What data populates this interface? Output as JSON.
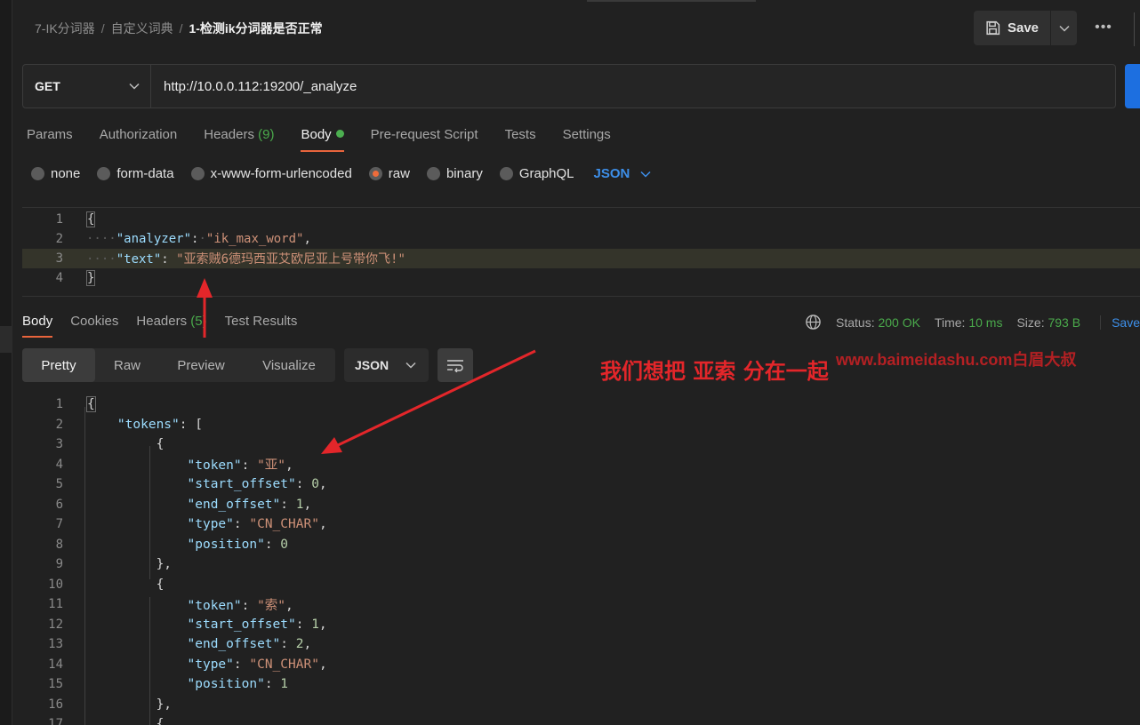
{
  "breadcrumb": {
    "items": [
      "7-IK分词器",
      "自定义词典"
    ],
    "current": "1-检测ik分词器是否正常",
    "separator": "/"
  },
  "toolbar": {
    "save_label": "Save",
    "more_label": "•••"
  },
  "request": {
    "method": "GET",
    "url": "http://10.0.0.112:19200/_analyze",
    "tabs": [
      "Params",
      "Authorization",
      "Headers",
      "Body",
      "Pre-request Script",
      "Tests",
      "Settings"
    ],
    "headers_count": "(9)",
    "active_tab": "Body",
    "body_types": [
      "none",
      "form-data",
      "x-www-form-urlencoded",
      "raw",
      "binary",
      "GraphQL"
    ],
    "selected_body_type": "raw",
    "raw_format": "JSON",
    "line_numbers": [
      "1",
      "2",
      "3",
      "4"
    ],
    "body": {
      "open": "{",
      "close": "}",
      "k1": "\"analyzer\"",
      "v1": "\"ik_max_word\"",
      "k2": "\"text\"",
      "v2": "\"亚索贼6德玛西亚艾欧尼亚上号带你飞!\""
    }
  },
  "response": {
    "tabs": [
      "Body",
      "Cookies",
      "Headers",
      "Test Results"
    ],
    "headers_count": "(5)",
    "active_tab": "Body",
    "status_label": "Status:",
    "status_value": "200 OK",
    "time_label": "Time:",
    "time_value": "10 ms",
    "size_label": "Size:",
    "size_value": "793 B",
    "save_label": "Save",
    "views": [
      "Pretty",
      "Raw",
      "Preview",
      "Visualize"
    ],
    "active_view": "Pretty",
    "format": "JSON",
    "line_numbers": [
      "1",
      "2",
      "3",
      "4",
      "5",
      "6",
      "7",
      "8",
      "9",
      "10",
      "11",
      "12",
      "13",
      "14",
      "15",
      "16",
      "17"
    ],
    "body": {
      "open": "{",
      "tokens_key": "\"tokens\"",
      "arr_open": "[",
      "obj_open": "{",
      "obj_close": "},",
      "k_token": "\"token\"",
      "k_start": "\"start_offset\"",
      "k_end": "\"end_offset\"",
      "k_type": "\"type\"",
      "k_pos": "\"position\"",
      "t1": {
        "token": "\"亚\"",
        "start": "0",
        "end": "1",
        "type": "\"CN_CHAR\"",
        "pos": "0"
      },
      "t2": {
        "token": "\"索\"",
        "start": "1",
        "end": "2",
        "type": "\"CN_CHAR\"",
        "pos": "1"
      }
    }
  },
  "annotation": {
    "text": "我们想把 亚索  分在一起",
    "watermark": "www.baimeidashu.com白眉大叔",
    "color": "#e3262a"
  },
  "colors": {
    "accent_orange": "#e8643c",
    "send_blue": "#1d6fe0",
    "status_green": "#4aa94b",
    "link_blue": "#3d8fe9"
  }
}
